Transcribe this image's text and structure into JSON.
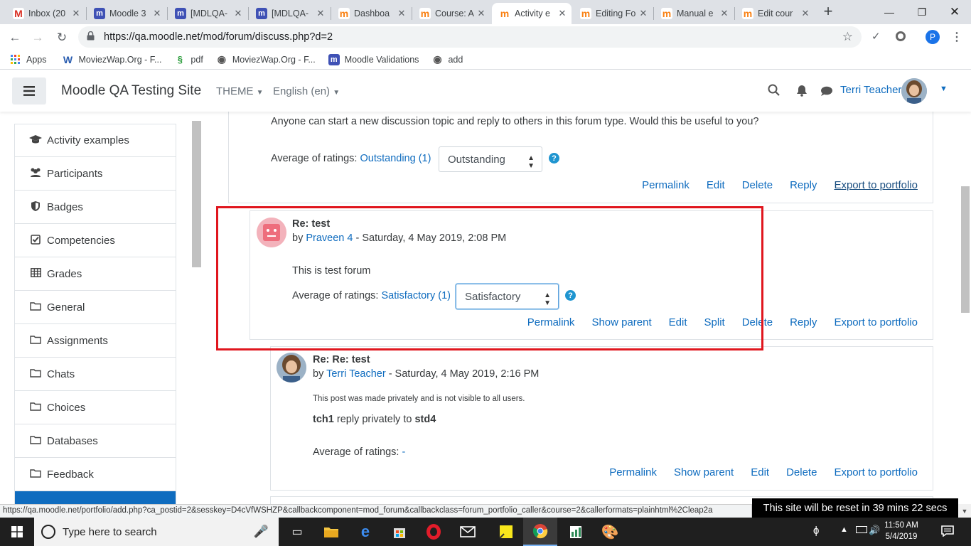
{
  "browser": {
    "tabs": [
      {
        "label": "Inbox (20",
        "favicon": "gmail-icon"
      },
      {
        "label": "Moodle 3",
        "favicon": "moodle-icon"
      },
      {
        "label": "[MDLQA-",
        "favicon": "moodle-icon"
      },
      {
        "label": "[MDLQA-",
        "favicon": "moodle-icon"
      },
      {
        "label": "Dashboa",
        "favicon": "moodle-site-icon"
      },
      {
        "label": "Course: A",
        "favicon": "moodle-site-icon"
      },
      {
        "label": "Activity e",
        "favicon": "moodle-site-icon",
        "active": true
      },
      {
        "label": "Editing Fo",
        "favicon": "moodle-site-icon"
      },
      {
        "label": "Manual e",
        "favicon": "moodle-site-icon"
      },
      {
        "label": "Edit cour",
        "favicon": "moodle-site-icon"
      }
    ],
    "url": "https://qa.moodle.net/mod/forum/discuss.php?d=2",
    "profile_initial": "P",
    "bookmarks": [
      {
        "label": "Apps",
        "icon": "apps-grid-icon"
      },
      {
        "label": "MoviezWap.Org - F...",
        "icon": "moviezwap-icon"
      },
      {
        "label": "pdf",
        "icon": "pdf-leaf-icon"
      },
      {
        "label": "MoviezWap.Org - F...",
        "icon": "globe-icon"
      },
      {
        "label": "Moodle Validations",
        "icon": "moodle-icon"
      },
      {
        "label": "add",
        "icon": "globe-icon"
      }
    ]
  },
  "navbar": {
    "site_name": "Moodle QA Testing Site",
    "theme_label": "THEME",
    "language_label": "English (en)",
    "user_name": "Terri Teacher"
  },
  "sidebar": {
    "items": [
      {
        "label": "Activity examples",
        "icon": "graduation-cap-icon"
      },
      {
        "label": "Participants",
        "icon": "users-icon"
      },
      {
        "label": "Badges",
        "icon": "shield-icon"
      },
      {
        "label": "Competencies",
        "icon": "checkbox-icon"
      },
      {
        "label": "Grades",
        "icon": "table-icon"
      },
      {
        "label": "General",
        "icon": "folder-icon"
      },
      {
        "label": "Assignments",
        "icon": "folder-icon"
      },
      {
        "label": "Chats",
        "icon": "folder-icon"
      },
      {
        "label": "Choices",
        "icon": "folder-icon"
      },
      {
        "label": "Databases",
        "icon": "folder-icon"
      },
      {
        "label": "Feedback",
        "icon": "folder-icon"
      }
    ]
  },
  "post1": {
    "message": "Anyone can start a new discussion topic and reply to others in this forum type. Would this be useful to you?",
    "ratings_label": "Average of ratings:",
    "ratings_value": "Outstanding (1)",
    "rating_select": "Outstanding",
    "commands": [
      "Permalink",
      "Edit",
      "Delete",
      "Reply",
      "Export to portfolio"
    ]
  },
  "post2": {
    "subject": "Re: test",
    "by": "by",
    "author": "Praveen 4",
    "date": "- Saturday, 4 May 2019, 2:08 PM",
    "message": "This is test forum",
    "ratings_label": "Average of ratings:",
    "ratings_value": "Satisfactory (1)",
    "rating_select": "Satisfactory",
    "commands": [
      "Permalink",
      "Show parent",
      "Edit",
      "Split",
      "Delete",
      "Reply",
      "Export to portfolio"
    ]
  },
  "post3": {
    "subject": "Re: Re: test",
    "by": "by",
    "author": "Terri Teacher",
    "date": "- Saturday, 4 May 2019, 2:16 PM",
    "private_notice": "This post was made privately and is not visible to all users.",
    "reply_from": "tch1",
    "reply_mid": "reply privately to",
    "reply_to": "std4",
    "ratings_label": "Average of ratings:",
    "ratings_value": "-",
    "commands": [
      "Permalink",
      "Show parent",
      "Edit",
      "Delete",
      "Export to portfolio"
    ]
  },
  "status": {
    "hover_url": "https://qa.moodle.net/portfolio/add.php?ca_postid=2&sesskey=D4cVfWSHZP&callbackcomponent=mod_forum&callbackclass=forum_portfolio_caller&course=2&callerformats=plainhtml%2Cleap2a",
    "reset_notice": "This site will be reset in 39 mins 22 secs"
  },
  "taskbar": {
    "search_placeholder": "Type here to search",
    "time": "11:50 AM",
    "date": "5/4/2019"
  }
}
